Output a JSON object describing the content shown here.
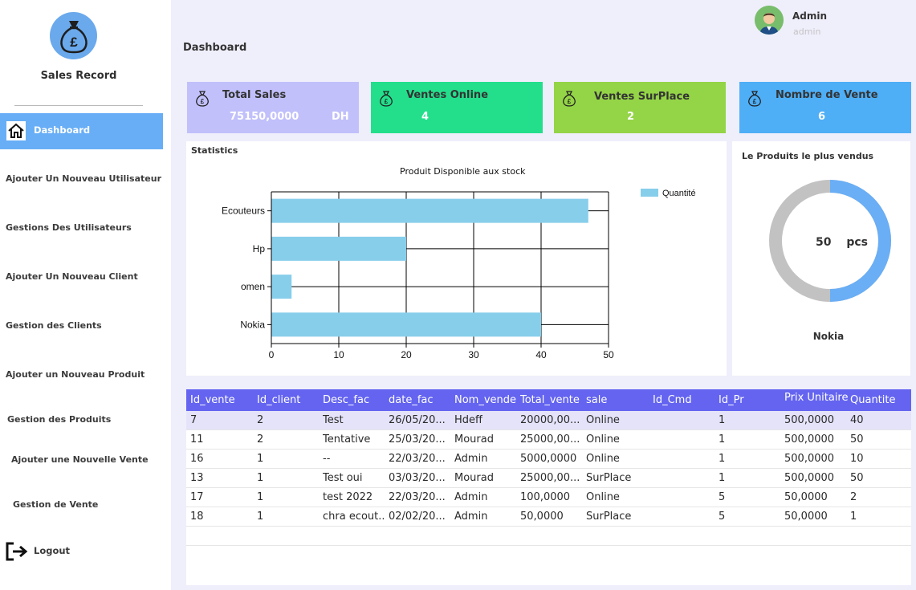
{
  "colors": {
    "background": "#efeefb",
    "sidebar": "#ffffff",
    "nav_active": "#68aef6",
    "card_total_sales": "#c1c0fb",
    "card_online": "#23df8c",
    "card_surplace": "#94d447",
    "card_count": "#4eaef6",
    "bar": "#87ceeb",
    "donut_primary": "#6aaef5",
    "donut_rest": "#c2c2c2",
    "table_header": "#6464f0"
  },
  "sidebar": {
    "logo_icon": "money-bag-icon",
    "app_name": "Sales Record",
    "active_item": {
      "icon": "home-icon",
      "label": "Dashboard"
    },
    "items": [
      {
        "label": "Ajouter Un Nouveau Utilisateur"
      },
      {
        "label": "Gestions Des Utilisateurs"
      },
      {
        "label": "Ajouter Un Nouveau Client"
      },
      {
        "label": "Gestion des Clients"
      },
      {
        "label": "Ajouter un Nouveau Produit"
      },
      {
        "label": "Gestion des Produits"
      },
      {
        "label": "Ajouter une Nouvelle Vente"
      },
      {
        "label": "Gestion de Vente"
      }
    ],
    "logout": {
      "icon": "logout-icon",
      "label": "Logout"
    }
  },
  "header": {
    "title": "Dashboard",
    "user": {
      "name": "Admin",
      "role": "admin",
      "avatar_icon": "user-avatar-icon"
    }
  },
  "cards": [
    {
      "title": "Total Sales",
      "value": "75150,0000",
      "unit": "DH",
      "icon": "money-bag-icon"
    },
    {
      "title": "Ventes Online",
      "value": "4",
      "icon": "money-bag-icon"
    },
    {
      "title": "Ventes SurPlace",
      "value": "2",
      "icon": "money-bag-icon"
    },
    {
      "title": "Nombre de Vente",
      "value": "6",
      "icon": "money-bag-icon"
    }
  ],
  "statistics": {
    "panel_title": "Statistics",
    "chart_data": {
      "type": "bar",
      "orientation": "horizontal",
      "title": "Produit Disponible aux stock",
      "categories": [
        "Ecouteurs",
        "Hp",
        "omen",
        "Nokia"
      ],
      "series": [
        {
          "name": "Quantité",
          "values": [
            47,
            20,
            3,
            40
          ]
        }
      ],
      "xlim": [
        0,
        50
      ],
      "xticks": [
        0,
        10,
        20,
        30,
        40,
        50
      ],
      "grid": true,
      "legend": "top-right"
    }
  },
  "top_product": {
    "title": "Le Produits le plus vendus",
    "value": "50",
    "unit": "pcs",
    "product": "Nokia",
    "share": 0.5
  },
  "table": {
    "columns": [
      "Id_vente",
      "Id_client",
      "Desc_fac",
      "date_fac",
      "Nom_vende",
      "Total_vente",
      "sale",
      "Id_Cmd",
      "Id_Pr",
      "Prix Unitaire",
      "Quantite"
    ],
    "rows": [
      [
        "7",
        "2",
        "Test",
        "26/05/20...",
        "Hdeff",
        "20000,00...",
        "Online",
        "",
        "1",
        "500,0000",
        "40"
      ],
      [
        "11",
        "2",
        "Tentative",
        "25/03/20...",
        "Mourad",
        "25000,00...",
        "Online",
        "",
        "1",
        "500,0000",
        "50"
      ],
      [
        "16",
        "1",
        "--",
        "22/03/20...",
        "Admin",
        "5000,0000",
        "Online",
        "",
        "1",
        "500,0000",
        "10"
      ],
      [
        "13",
        "1",
        "Test oui",
        "03/03/20...",
        "Mourad",
        "25000,00...",
        "SurPlace",
        "",
        "1",
        "500,0000",
        "50"
      ],
      [
        "17",
        "1",
        "test 2022",
        "22/03/20...",
        "Admin",
        "100,0000",
        "Online",
        "",
        "5",
        "50,0000",
        "2"
      ],
      [
        "18",
        "1",
        "chra ecout...",
        "02/02/20...",
        "Admin",
        "50,0000",
        "SurPlace",
        "",
        "5",
        "50,0000",
        "1"
      ]
    ]
  }
}
